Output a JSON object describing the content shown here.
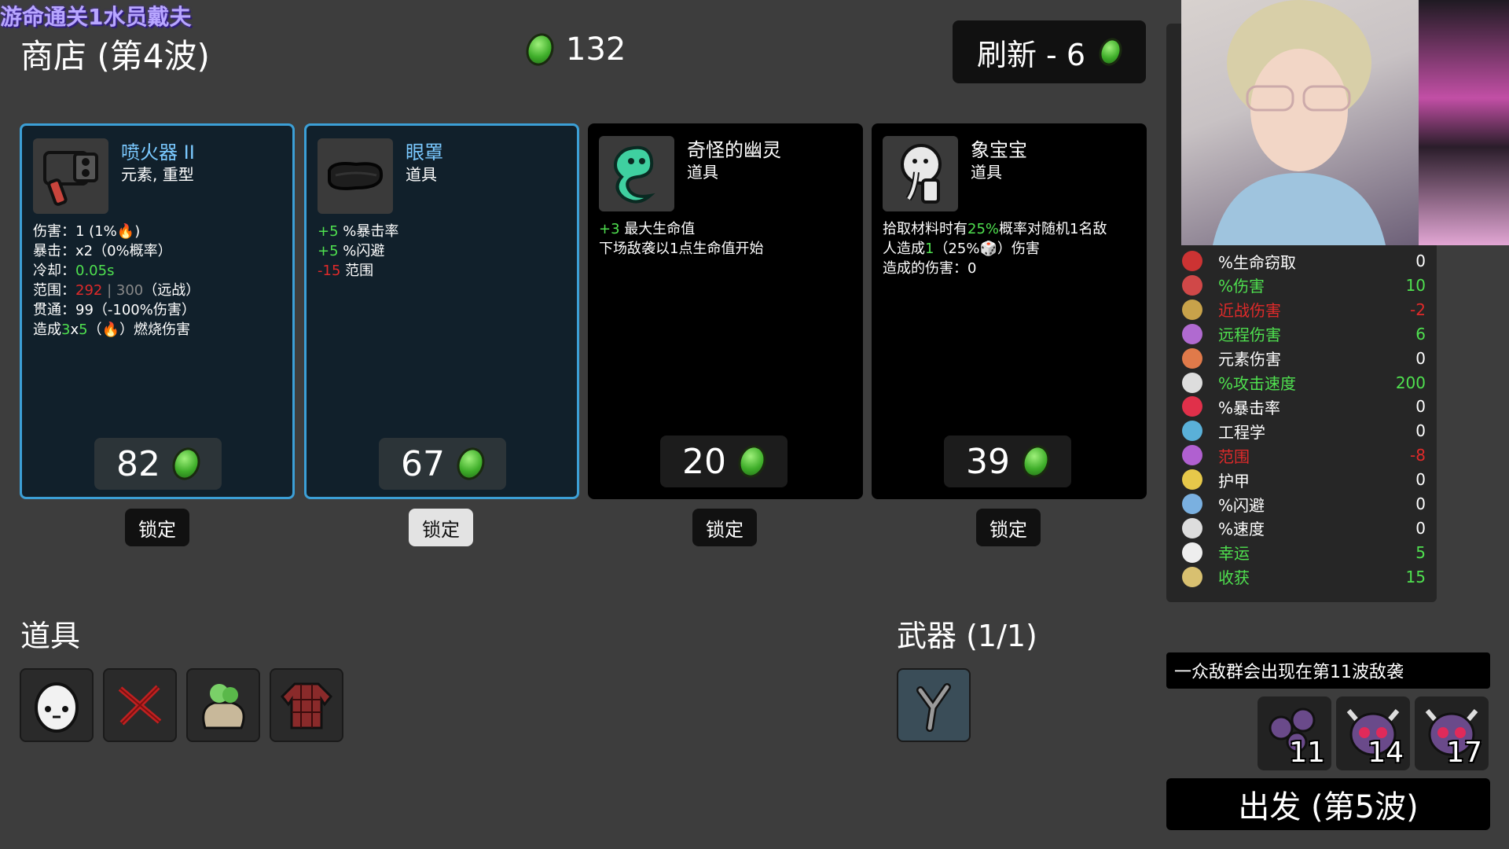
{
  "stream_overlay": "游命通关1水员戴夫",
  "shop": {
    "title": "商店 (第4波)",
    "currency": "132",
    "reroll_label": "刷新 - 6"
  },
  "cards": [
    {
      "name": "喷火器 II",
      "type": "元素, 重型",
      "lines": [
        [
          {
            "t": "伤害：1 (1%"
          },
          {
            "t": "🔥",
            "c": "#e07a4a"
          },
          {
            "t": ")"
          }
        ],
        [
          {
            "t": "暴击：x2（0%概率）"
          }
        ],
        [
          {
            "t": "冷却：",
            "c": "#fff"
          },
          {
            "t": "0.05s",
            "c": "#4fe04f"
          }
        ],
        [
          {
            "t": "范围："
          },
          {
            "t": "292",
            "c": "#e02a2a"
          },
          {
            "t": " | ",
            "c": "#888"
          },
          {
            "t": "300",
            "c": "#888"
          },
          {
            "t": "（远战）"
          }
        ],
        [
          {
            "t": "贯通：99（-100%伤害）"
          }
        ],
        [
          {
            "t": "造成"
          },
          {
            "t": "3",
            "c": "#4fe04f"
          },
          {
            "t": "x"
          },
          {
            "t": "5",
            "c": "#4fe04f"
          },
          {
            "t": "（"
          },
          {
            "t": "🔥",
            "c": "#e07a4a"
          },
          {
            "t": "）燃烧伤害"
          }
        ]
      ],
      "price": "82",
      "lock": "锁定",
      "locked": false
    },
    {
      "name": "眼罩",
      "type": "道具",
      "lines": [
        [
          {
            "t": "+5",
            "c": "#4fe04f"
          },
          {
            "t": " %暴击率"
          }
        ],
        [
          {
            "t": "+5",
            "c": "#4fe04f"
          },
          {
            "t": " %闪避"
          }
        ],
        [
          {
            "t": "-15",
            "c": "#e02a2a"
          },
          {
            "t": " 范围"
          }
        ]
      ],
      "price": "67",
      "lock": "锁定",
      "locked": true
    },
    {
      "name": "奇怪的幽灵",
      "type": "道具",
      "lines": [
        [
          {
            "t": "+3",
            "c": "#4fe04f"
          },
          {
            "t": " 最大生命值"
          }
        ],
        [
          {
            "t": "下场敌袭以1点生命值开始"
          }
        ]
      ],
      "price": "20",
      "lock": "锁定",
      "locked": false
    },
    {
      "name": "象宝宝",
      "type": "道具",
      "lines": [
        [
          {
            "t": "拾取材料时有"
          },
          {
            "t": "25%",
            "c": "#4fe04f"
          },
          {
            "t": "概率对随机1名敌"
          }
        ],
        [
          {
            "t": "人造成"
          },
          {
            "t": "1",
            "c": "#4fe04f"
          },
          {
            "t": "（25%"
          },
          {
            "t": "🎲"
          },
          {
            "t": "）伤害"
          }
        ],
        [
          {
            "t": "造成的伤害：0"
          }
        ]
      ],
      "price": "39",
      "lock": "锁定",
      "locked": false
    }
  ],
  "items_title": "道具",
  "weapons_title": "武器 (1/1)",
  "stats": [
    {
      "label": "%生命窃取",
      "value": "0",
      "color": "#ffffff",
      "icon": "heart-drop-icon",
      "ic": "#c33"
    },
    {
      "label": "%伤害",
      "value": "10",
      "color": "#4fe04f",
      "icon": "muscle-icon",
      "ic": "#d04848"
    },
    {
      "label": "近战伤害",
      "value": "-2",
      "color": "#e02a2a",
      "icon": "sword-icon",
      "ic": "#c8a24a"
    },
    {
      "label": "远程伤害",
      "value": "6",
      "color": "#4fe04f",
      "icon": "bow-icon",
      "ic": "#b06ad0"
    },
    {
      "label": "元素伤害",
      "value": "0",
      "color": "#ffffff",
      "icon": "flame-icon",
      "ic": "#e07a4a"
    },
    {
      "label": "%攻击速度",
      "value": "200",
      "color": "#4fe04f",
      "icon": "hourglass-icon",
      "ic": "#ddd"
    },
    {
      "label": "%暴击率",
      "value": "0",
      "color": "#ffffff",
      "icon": "crit-icon",
      "ic": "#e0304a"
    },
    {
      "label": "工程学",
      "value": "0",
      "color": "#ffffff",
      "icon": "wrench-icon",
      "ic": "#5ab0d8"
    },
    {
      "label": "范围",
      "value": "-8",
      "color": "#e02a2a",
      "icon": "range-icon",
      "ic": "#b060d0"
    },
    {
      "label": "护甲",
      "value": "0",
      "color": "#ffffff",
      "icon": "shield-icon",
      "ic": "#e6c84a"
    },
    {
      "label": "%闪避",
      "value": "0",
      "color": "#ffffff",
      "icon": "dodge-icon",
      "ic": "#7ab0e0"
    },
    {
      "label": "%速度",
      "value": "0",
      "color": "#ffffff",
      "icon": "boot-icon",
      "ic": "#ddd"
    },
    {
      "label": "幸运",
      "value": "5",
      "color": "#4fe04f",
      "icon": "dice-icon",
      "ic": "#eee"
    },
    {
      "label": "收获",
      "value": "15",
      "color": "#4fe04f",
      "icon": "wheat-icon",
      "ic": "#d8c070"
    }
  ],
  "notice": "一众敌群会出现在第11波敌袭",
  "enemy_waves": [
    "11",
    "14",
    "17"
  ],
  "go_label": "出发 (第5波)",
  "colors": {
    "accent_blue": "#3c9fd6",
    "positive": "#4fe04f",
    "negative": "#e02a2a",
    "bg": "#3d3d3d"
  }
}
